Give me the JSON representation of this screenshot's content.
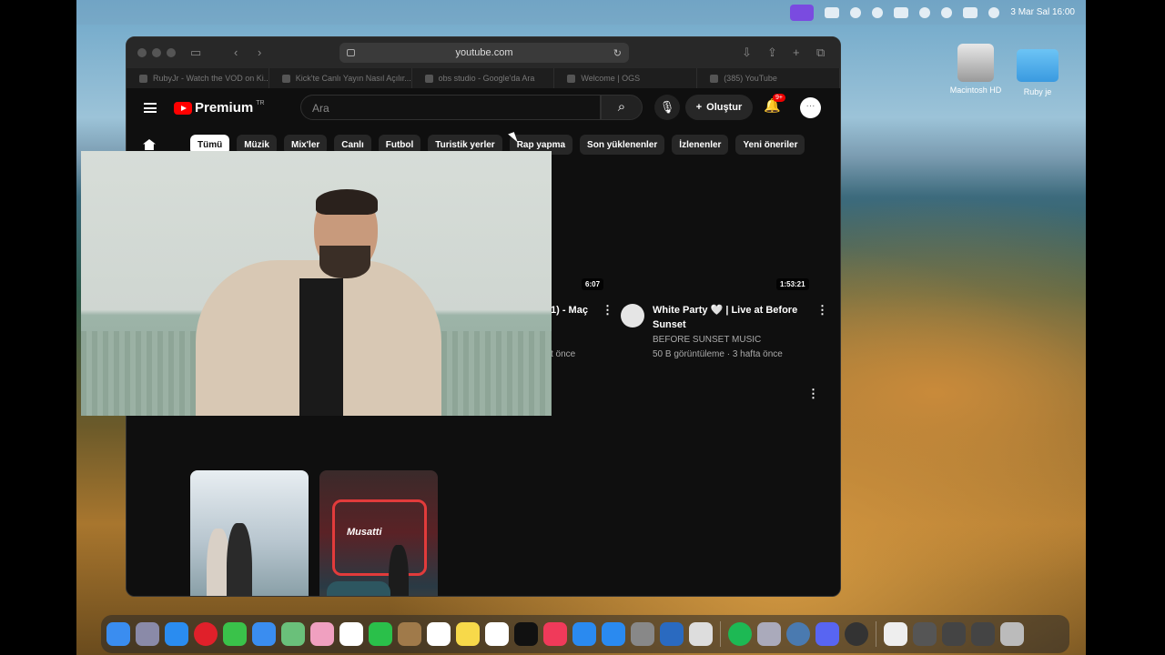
{
  "menubar": {
    "datetime": "3 Mar Sal  16:00"
  },
  "desktop": {
    "icons": [
      {
        "label": "Macintosh HD"
      },
      {
        "label": "Ruby je"
      }
    ]
  },
  "browser": {
    "url": "youtube.com",
    "tabs": [
      {
        "label": "RubyJr - Watch the VOD on Ki..."
      },
      {
        "label": "Kick'te Canlı Yayın Nasıl Açılır..."
      },
      {
        "label": "obs studio - Google'da Ara"
      },
      {
        "label": "Welcome | OGS"
      },
      {
        "label": "(385) YouTube"
      }
    ]
  },
  "youtube": {
    "logo": "Premium",
    "logo_region": "TR",
    "search_placeholder": "Ara",
    "create_label": "Oluştur",
    "notification_count": "9+",
    "chips": [
      "Tümü",
      "Müzik",
      "Mix'ler",
      "Canlı",
      "Futbol",
      "Turistik yerler",
      "Rap yapma",
      "Son yüklenenler",
      "İzlenenler",
      "Yeni öneriler"
    ],
    "videos": [
      {
        "duration": "6:07",
        "title_fragment": "1) - Maç",
        "meta_fragment": "t önce"
      },
      {
        "duration": "1:53:21",
        "title": "White Party 🤍 | Live at Before Sunset",
        "channel": "BEFORE SUNSET MUSIC",
        "meta": "50 B görüntüleme · 3 hafta önce"
      }
    ],
    "short2_sign": "Musatti"
  },
  "colors": {
    "yt_bg": "#0f0f0f",
    "yt_red": "#ff0000",
    "chip_active": "#ffffff",
    "menubar_accent": "#7a4be0"
  }
}
